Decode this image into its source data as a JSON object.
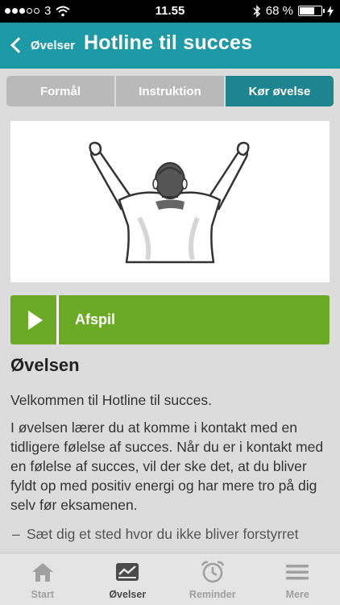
{
  "status_bar": {
    "carrier": "3",
    "time": "11.55",
    "battery_percent": "68 %",
    "battery_level": 0.68,
    "icons": [
      "wifi-icon",
      "bluetooth-icon",
      "charging-icon"
    ]
  },
  "nav": {
    "back_label": "Øvelser",
    "title": "Hotline til succes"
  },
  "tabs": [
    {
      "label": "Formål",
      "active": false
    },
    {
      "label": "Instruktion",
      "active": false
    },
    {
      "label": "Kør øvelse",
      "active": true
    }
  ],
  "player": {
    "label": "Afspil",
    "icon": "play-icon"
  },
  "exercise": {
    "heading": "Øvelsen",
    "intro": "Velkommen til Hotline til succes.",
    "body": "I øvelsen lærer du at komme i kontakt med en tidligere følelse af succes.  Når du er i kontakt med en følelse af succes, vil der ske det, at du bliver fyldt op med positiv energi og har mere tro på dig selv før eksamenen.",
    "bullet_partial": "Sæt dig et sted hvor du ikke bliver forstyrret"
  },
  "tab_bar": [
    {
      "label": "Start",
      "icon": "home-icon",
      "active": false
    },
    {
      "label": "Øvelser",
      "icon": "exercises-icon",
      "active": true
    },
    {
      "label": "Reminder",
      "icon": "alarm-clock-icon",
      "active": false
    },
    {
      "label": "Mere",
      "icon": "menu-icon",
      "active": false
    }
  ],
  "colors": {
    "nav_bar": "#1e9aa6",
    "active_segment": "#1e8590",
    "inactive_segment": "#b9b9b9",
    "play_bar": "#6aaa24"
  }
}
